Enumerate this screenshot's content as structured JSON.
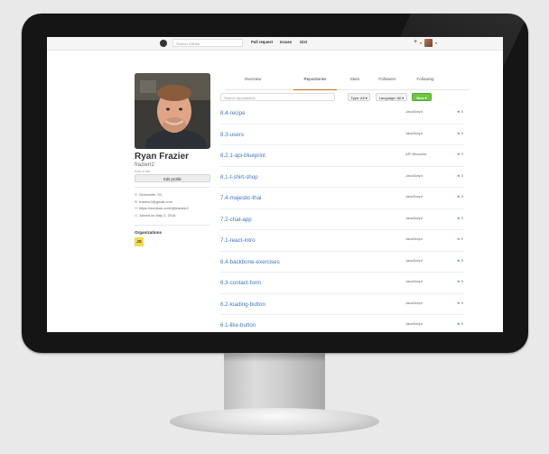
{
  "topbar": {
    "search_placeholder": "Search GitHub",
    "links": [
      "Pull request",
      "Issues",
      "Gist"
    ],
    "plus": "+",
    "caret": "▾"
  },
  "profile": {
    "name": "Ryan Frazier",
    "login": "frazierr2",
    "add_bio": "Add a bio",
    "edit_button": "Edit profile",
    "details": [
      {
        "icon": "location-icon",
        "glyph": "⚲",
        "text": "Greenville, SC"
      },
      {
        "icon": "mail-icon",
        "glyph": "✉",
        "text": "frazierr2@gmail.com"
      },
      {
        "icon": "link-icon",
        "glyph": "⚯",
        "text": "https://medium.com/@frazierr2"
      },
      {
        "icon": "clock-icon",
        "glyph": "◷",
        "text": "Joined on May 2, 2016"
      }
    ],
    "organizations_title": "Organizations",
    "org_badge": "JS"
  },
  "tabs": [
    "Overview",
    "Repositories",
    "Stars",
    "Followers",
    "Following"
  ],
  "active_tab": "Repositories",
  "filters": {
    "search_placeholder": "Search repositories",
    "type_label": "Type: All ▾",
    "language_label": "Language: All ▾",
    "new_label": "New ▾"
  },
  "repos": [
    {
      "name": "8.4-recipe",
      "language": "JavaScript",
      "stars": "0"
    },
    {
      "name": "8.3-users",
      "language": "JavaScript",
      "stars": "0"
    },
    {
      "name": "8.2.1-api-blueprint",
      "language": "API Blueprint",
      "stars": "0"
    },
    {
      "name": "8.1-t-shirt-shop",
      "language": "JavaScript",
      "stars": "0"
    },
    {
      "name": "7.4-majestic-thai",
      "language": "JavaScript",
      "stars": "0"
    },
    {
      "name": "7.2-chat-app",
      "language": "JavaScript",
      "stars": "0"
    },
    {
      "name": "7.1-react-intro",
      "language": "JavaScript",
      "stars": "0"
    },
    {
      "name": "6.4-backbone-exercises",
      "language": "JavaScript",
      "stars": "0"
    },
    {
      "name": "6.3-contact-form",
      "language": "JavaScript",
      "stars": "0"
    },
    {
      "name": "6.2-loading-button",
      "language": "JavaScript",
      "stars": "0"
    },
    {
      "name": "6.1-like-button",
      "language": "JavaScript",
      "stars": "0"
    }
  ],
  "colors": {
    "link": "#4078c0",
    "accent_tab": "#d26911",
    "new_button": "#6cc644",
    "bezel": "#151515"
  }
}
